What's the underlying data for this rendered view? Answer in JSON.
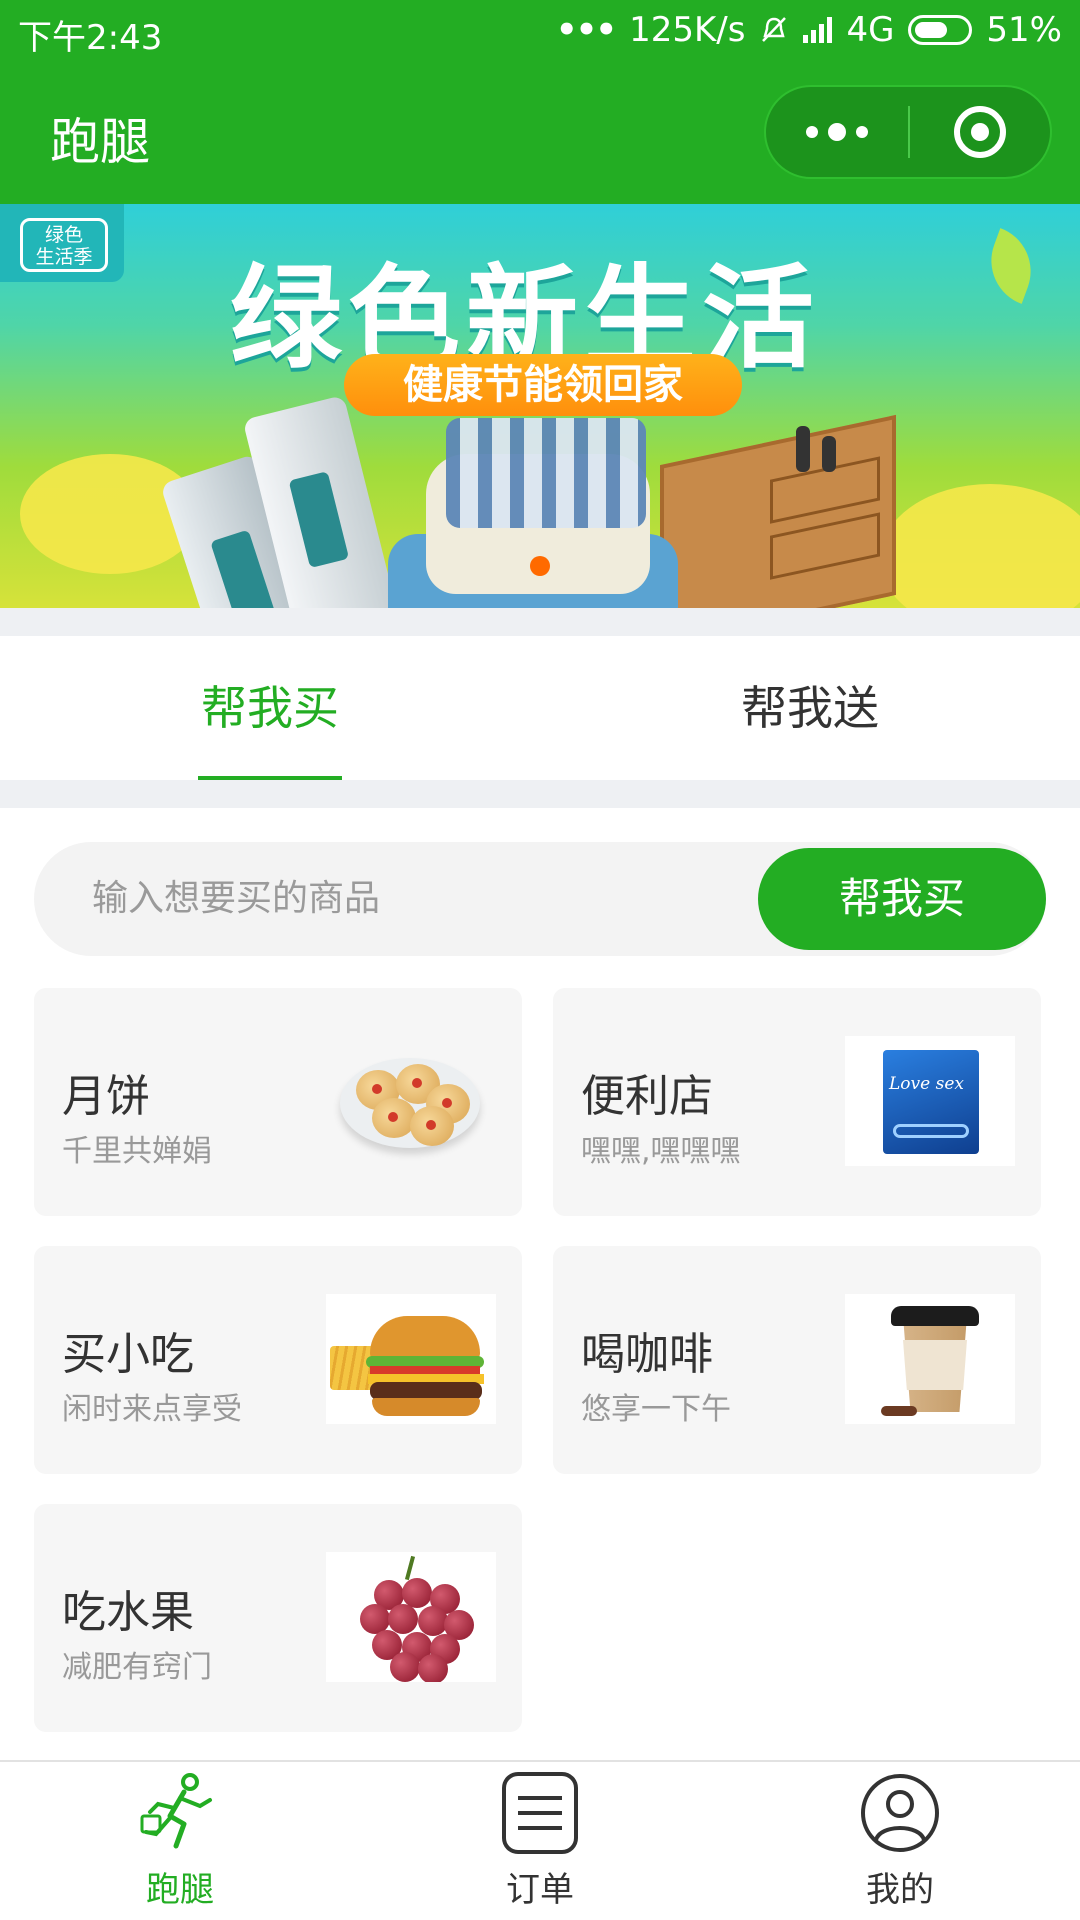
{
  "status_bar": {
    "time": "下午2:43",
    "dots": "•••",
    "speed": "125K/s",
    "network": "4G",
    "battery": "51%"
  },
  "nav": {
    "title": "跑腿"
  },
  "banner": {
    "badge": "绿色\n生活季",
    "badge_line1": "绿色",
    "badge_line2": "生活季",
    "headline": "绿色新生活",
    "pill": "健康节能领回家"
  },
  "tabs": [
    {
      "label": "帮我买",
      "active": true
    },
    {
      "label": "帮我送",
      "active": false
    }
  ],
  "search": {
    "placeholder": "输入想要买的商品",
    "button": "帮我买"
  },
  "cards": [
    {
      "title": "月饼",
      "subtitle": "千里共婵娟",
      "thumb": "mooncake-image"
    },
    {
      "title": "便利店",
      "subtitle": "嘿嘿,嘿嘿嘿",
      "thumb": "product-box-image",
      "thumb_text": "Love sex"
    },
    {
      "title": "买小吃",
      "subtitle": "闲时来点享受",
      "thumb": "burger-image"
    },
    {
      "title": "喝咖啡",
      "subtitle": "悠享一下午",
      "thumb": "coffee-cup-image"
    },
    {
      "title": "吃水果",
      "subtitle": "减肥有窍门",
      "thumb": "grapes-image"
    }
  ],
  "tabbar": [
    {
      "label": "跑腿",
      "icon": "runner-icon",
      "active": true
    },
    {
      "label": "订单",
      "icon": "order-list-icon",
      "active": false
    },
    {
      "label": "我的",
      "icon": "user-profile-icon",
      "active": false
    }
  ],
  "colors": {
    "brand_green": "#23ad23",
    "banner_dot": "#ff6a00"
  }
}
